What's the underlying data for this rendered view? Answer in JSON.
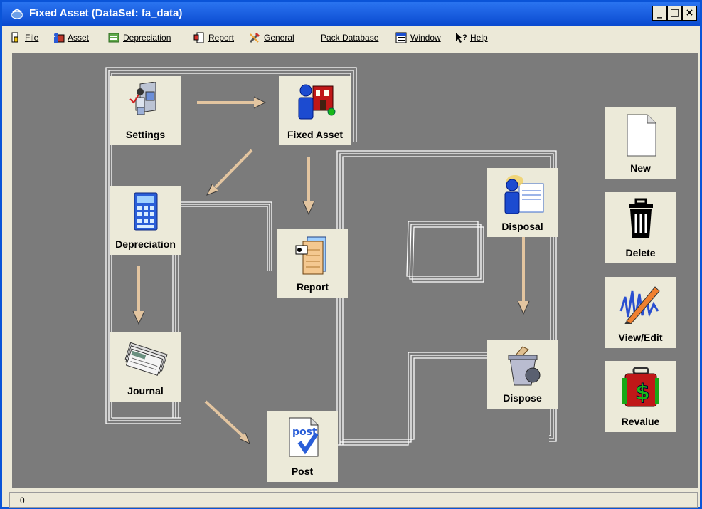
{
  "window": {
    "title": "Fixed Asset  (DataSet: fa_data)"
  },
  "titlebar_buttons": {
    "minimize": "_",
    "maximize": "□",
    "close": "×"
  },
  "menu": [
    {
      "label": "File",
      "icon": "file-icon"
    },
    {
      "label": "Asset",
      "icon": "asset-icon"
    },
    {
      "label": "Depreciation",
      "icon": "depreciation-icon"
    },
    {
      "label": "Report",
      "icon": "report-icon"
    },
    {
      "label": "General",
      "icon": "general-icon"
    },
    {
      "label": "Pack Database",
      "icon": ""
    },
    {
      "label": "Window",
      "icon": "window-icon"
    },
    {
      "label": "Help",
      "icon": "help-icon"
    }
  ],
  "flow": {
    "settings": "Settings",
    "fixed_asset": "Fixed Asset",
    "depreciation": "Depreciation",
    "report": "Report",
    "journal": "Journal",
    "post": "Post",
    "disposal": "Disposal",
    "dispose": "Dispose"
  },
  "actions": {
    "new": "New",
    "delete": "Delete",
    "view_edit": "View/Edit",
    "revalue": "Revalue"
  },
  "post_icon_text": "post",
  "status": {
    "text": "0"
  },
  "colors": {
    "titlebar": "#0a4fd6",
    "canvas": "#7b7b7b",
    "tile": "#ecead9",
    "arrow": "#e3c5a0"
  }
}
